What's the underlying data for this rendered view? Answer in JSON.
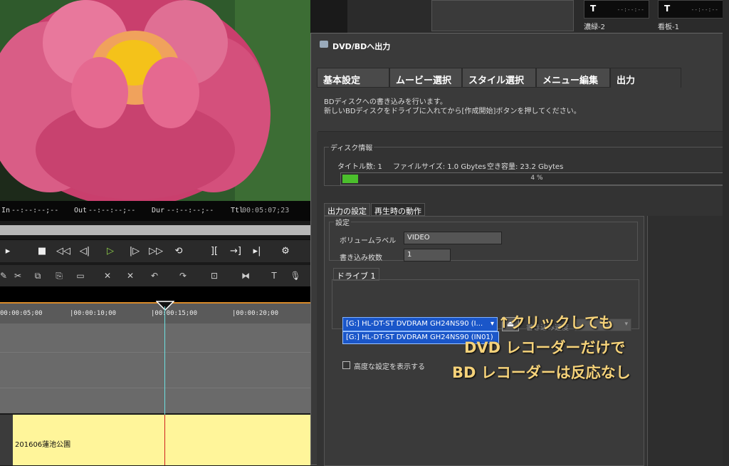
{
  "timecode": {
    "in_label": "In",
    "in_value": "--:--:--;--",
    "out_label": "Out",
    "out_value": "--:--:--;--",
    "dur_label": "Dur",
    "dur_value": "--:--:--;--",
    "ttl_label": "Ttl",
    "ttl_value": "00:05:07;23"
  },
  "transport": {
    "stop": "■",
    "rew": "◁◁",
    "step_back": "◁|",
    "play": "▷",
    "step_fwd": "|▷",
    "ff": "▷▷",
    "loop": "⟲"
  },
  "timeline": {
    "ticks": [
      "00:00:05;00",
      "|00:00:10;00",
      "|00:00:15;00",
      "|00:00:20;00"
    ],
    "clip_title": "201606蓮池公園"
  },
  "top_panels": [
    {
      "glyph": "T",
      "timecode": "--:--:--",
      "label": "濃緑-2"
    },
    {
      "glyph": "T",
      "timecode": "--:--:--",
      "label": "看板-1"
    }
  ],
  "dialog": {
    "title": "DVD/BDへ出力",
    "tabs": [
      "基本設定",
      "ムービー選択",
      "スタイル選択",
      "メニュー編集",
      "出力"
    ],
    "intro_line1": "BDディスクへの書き込みを行います。",
    "intro_line2": "新しいBDディスクをドライブに入れてから[作成開始]ボタンを押してください。",
    "disc_info": {
      "legend": "ディスク情報",
      "titles": "タイトル数: 1",
      "filesize": "ファイルサイズ: 1.0 Gbytes",
      "free": "空き容量: 23.2 Gbytes",
      "progress_percent": 4,
      "progress_text": "4 %"
    },
    "sub_tabs": [
      "出力の設定",
      "再生時の動作"
    ],
    "settings": {
      "legend": "設定",
      "volume_label": "ボリュームラベル",
      "volume_value": "VIDEO",
      "copies_label": "書き込み枚数",
      "copies_value": "1"
    },
    "drive": {
      "tab": "ドライブ 1",
      "selected": "[G:] HL-DT-ST DVDRAM GH24NS90 (I...",
      "option": "[G:] HL-DT-ST DVDRAM GH24NS90 (IN01)",
      "eject_glyph": "⏏",
      "speed_label": "書き込み速度"
    },
    "advanced_checkbox": "高度な設定を表示する"
  },
  "annotation": {
    "line1": "↑クリックしても",
    "line2": "DVD レコーダーだけで",
    "line3": "BD レコーダーは反応なし"
  }
}
